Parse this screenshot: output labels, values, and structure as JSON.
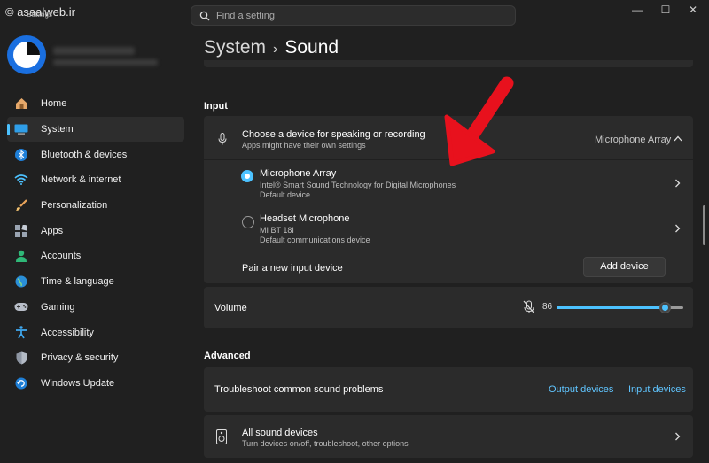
{
  "watermark": "© asaalweb.ir",
  "app_title": "Settings",
  "search": {
    "placeholder": "Find a setting"
  },
  "window_controls": {
    "minimize": "—",
    "maximize": "☐",
    "close": "✕"
  },
  "nav": {
    "items": [
      {
        "label": "Home",
        "icon": "home-icon"
      },
      {
        "label": "System",
        "icon": "system-icon",
        "active": true
      },
      {
        "label": "Bluetooth & devices",
        "icon": "bluetooth-icon"
      },
      {
        "label": "Network & internet",
        "icon": "wifi-icon"
      },
      {
        "label": "Personalization",
        "icon": "brush-icon"
      },
      {
        "label": "Apps",
        "icon": "apps-icon"
      },
      {
        "label": "Accounts",
        "icon": "person-icon"
      },
      {
        "label": "Time & language",
        "icon": "globe-icon"
      },
      {
        "label": "Gaming",
        "icon": "controller-icon"
      },
      {
        "label": "Accessibility",
        "icon": "accessibility-icon"
      },
      {
        "label": "Privacy & security",
        "icon": "shield-icon"
      },
      {
        "label": "Windows Update",
        "icon": "update-icon"
      }
    ]
  },
  "breadcrumb": {
    "parent": "System",
    "separator": "›",
    "current": "Sound"
  },
  "input": {
    "heading": "Input",
    "choose": {
      "title": "Choose a device for speaking or recording",
      "subtitle": "Apps might have their own settings",
      "selected": "Microphone Array"
    },
    "devices": [
      {
        "name": "Microphone Array",
        "desc": "Intel® Smart Sound Technology for Digital Microphones",
        "role": "Default device",
        "selected": true
      },
      {
        "name": "Headset Microphone",
        "desc": "MI BT 18I",
        "role": "Default communications device",
        "selected": false
      }
    ],
    "pair": {
      "label": "Pair a new input device",
      "button": "Add device"
    },
    "volume": {
      "label": "Volume",
      "value": "86",
      "level": 86
    }
  },
  "advanced": {
    "heading": "Advanced",
    "troubleshoot": {
      "label": "Troubleshoot common sound problems",
      "output_link": "Output devices",
      "input_link": "Input devices"
    },
    "all_devices": {
      "title": "All sound devices",
      "subtitle": "Turn devices on/off, troubleshoot, other options"
    }
  },
  "colors": {
    "accent": "#4cc2ff",
    "background": "#202020",
    "card": "#2b2b2b",
    "annotation_arrow": "#e8111d"
  }
}
